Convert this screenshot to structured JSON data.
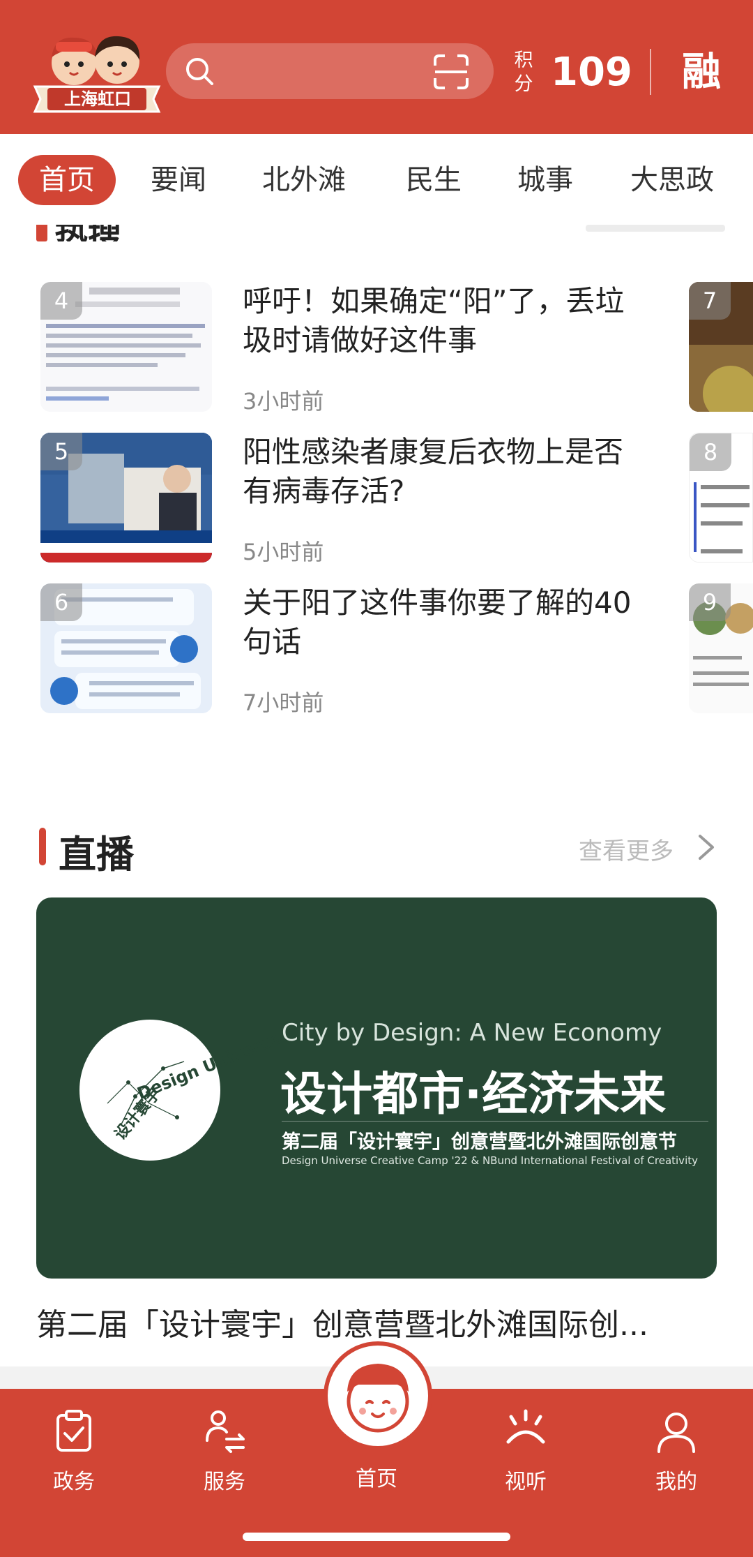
{
  "header": {
    "logo_text": "上海虹口",
    "points_label": "积分",
    "points_value": "109",
    "rong_label": "融"
  },
  "tabs": [
    {
      "label": "首页",
      "active": true
    },
    {
      "label": "要闻"
    },
    {
      "label": "北外滩"
    },
    {
      "label": "民生"
    },
    {
      "label": "城事"
    },
    {
      "label": "大思政"
    }
  ],
  "hot_section": {
    "title": "热搜"
  },
  "news": [
    {
      "rank": "4",
      "title": "呼吁！如果确定“阳”了，丢垃圾时请做好这件事",
      "time": "3小时前"
    },
    {
      "rank": "5",
      "title": "阳性感染者康复后衣物上是否有病毒存活?",
      "time": "5小时前"
    },
    {
      "rank": "6",
      "title": "关于阳了这件事你要了解的40句话",
      "time": "7小时前"
    }
  ],
  "side_ranks": [
    "7",
    "8",
    "9"
  ],
  "live": {
    "title": "直播",
    "more": "查看更多",
    "card_en_title": "City by Design: A New Economy",
    "card_cn_title": "设计都市·经济未来",
    "card_cn_sub": "第二届「设计寰宇」创意营暨北外滩国际创意节",
    "card_en_sub": "Design Universe Creative Camp '22 & NBund International Festival of Creativity",
    "circle_text": "Design Universe",
    "circle_cn": "设计寰宇",
    "caption": "第二届「设计寰宇」创意营暨北外滩国际创..."
  },
  "bottom_nav": [
    {
      "label": "政务",
      "icon": "clipboard-check-icon"
    },
    {
      "label": "服务",
      "icon": "service-icon"
    },
    {
      "label": "首页",
      "icon": "mascot-icon"
    },
    {
      "label": "视听",
      "icon": "broadcast-icon"
    },
    {
      "label": "我的",
      "icon": "user-icon"
    }
  ],
  "colors": {
    "brand_red": "#d24535",
    "live_card_green": "#264734"
  }
}
